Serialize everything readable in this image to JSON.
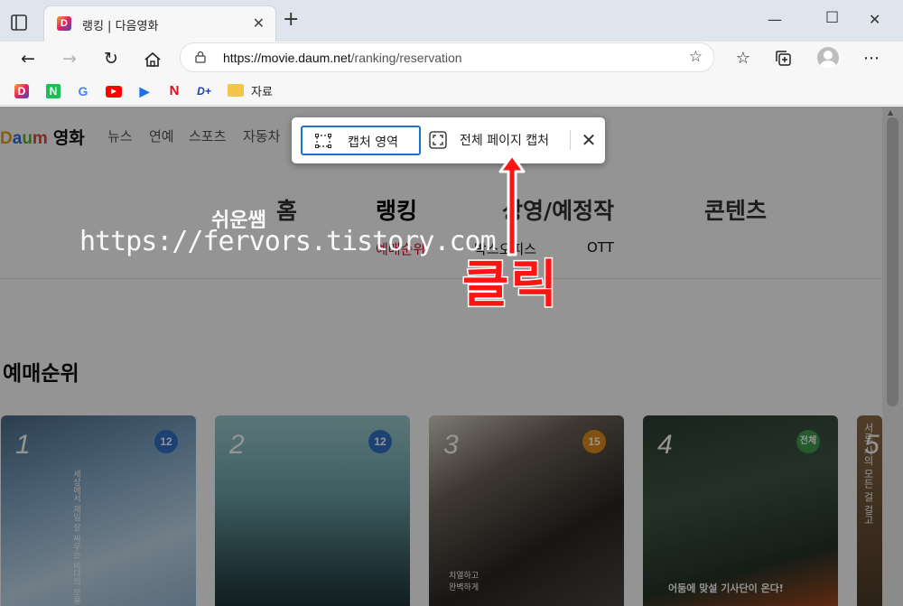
{
  "browser": {
    "tab_title": "랭킹 | 다음영화",
    "tab_favicon": "D",
    "url_domain": "https://movie.daum.net",
    "url_path": "/ranking/reservation",
    "bookmark_folder": "자료"
  },
  "site": {
    "logo": [
      "D",
      "a",
      "u",
      "m"
    ],
    "service": "영화",
    "gnb": [
      "뉴스",
      "연예",
      "스포츠",
      "자동차"
    ],
    "main_menu": [
      "홈",
      "랭킹",
      "상영/예정작",
      "콘텐츠"
    ],
    "sub_menu": [
      "예매순위",
      "박스오피스",
      "OTT"
    ],
    "section_title": "예매순위"
  },
  "movies": [
    {
      "rank": "1",
      "age": "12",
      "age_color": "#2f73c5",
      "poster_text": "세상에서 제일 잘 싸우는 바다의 보물"
    },
    {
      "rank": "2",
      "age": "12",
      "age_color": "#2f73c5",
      "poster_text": ""
    },
    {
      "rank": "3",
      "age": "15",
      "age_color": "#e08b1a",
      "poster_text": "치열하고 완벽하게"
    },
    {
      "rank": "4",
      "age": "전체",
      "age_color": "#3e9b4f",
      "poster_text": "어둠에 맞설 기사단이 온다!"
    },
    {
      "rank": "5",
      "age": "",
      "age_color": "",
      "poster_text": "서로 사의 모든 걸 걸고"
    }
  ],
  "capture_toolbar": {
    "area_label": "캡처 영역",
    "full_label": "전체 페이지 캡처"
  },
  "annotations": {
    "watermark_name": "쉬운쌤",
    "watermark_url": "https://fervors.tistory.com",
    "click_label": "클릭"
  }
}
